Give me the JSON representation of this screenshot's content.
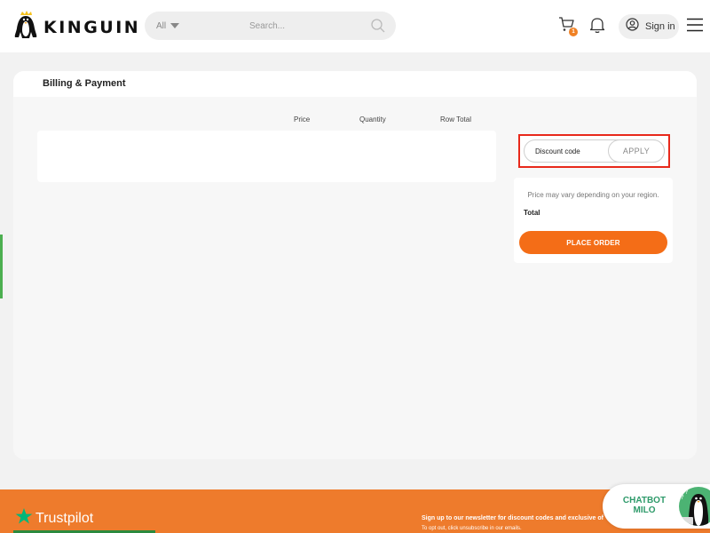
{
  "header": {
    "logo_text": "KINGUIN",
    "category_select": "All",
    "search_placeholder": "Search...",
    "cart_count": "1",
    "signin_label": "Sign in"
  },
  "checkout": {
    "title": "Billing & Payment",
    "columns": [
      "Price",
      "Quantity",
      "Row Total"
    ],
    "discount_placeholder": "Discount code",
    "apply_label": "APPLY",
    "region_note": "Price may vary depending on your region.",
    "total_label": "Total",
    "place_order_label": "PLACE ORDER"
  },
  "footer": {
    "trustpilot": "Trustpilot",
    "newsletter": "Sign up to our newsletter for discount codes and exclusive of",
    "optout": "To opt out, click unsubscribe in our emails."
  },
  "chatbot": {
    "line1": "CHATBOT",
    "line2": "MILO"
  },
  "colors": {
    "accent": "#f46d17",
    "footer": "#ee7b2c",
    "highlight": "#e8291b",
    "trustpilot_star": "#00b67a",
    "chatbot_text": "#2e9a6a"
  }
}
